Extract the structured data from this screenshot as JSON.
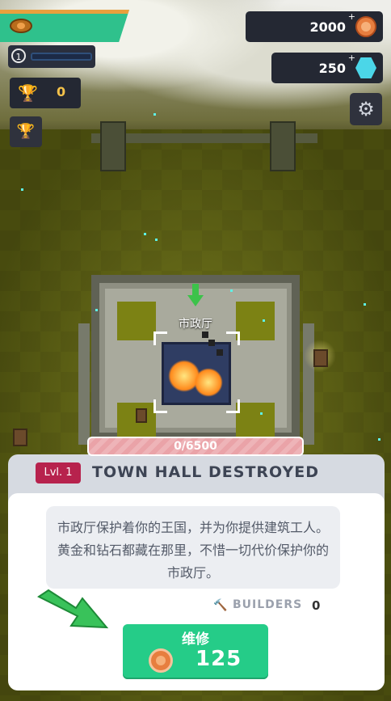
{
  "hud": {
    "level": "1",
    "trophies": "0",
    "gold": "2000",
    "gems": "250",
    "plus": "+"
  },
  "map": {
    "building_label": "市政厅"
  },
  "panel": {
    "progress_text": "0/6500",
    "level_badge": "Lvl. 1",
    "title": "TOWN HALL DESTROYED",
    "description": "市政厅保护着你的王国，并为你提供建筑工人。 黄金和钻石都藏在那里，不惜一切代价保护你的市政厅。",
    "builders_label": "BUILDERS",
    "builders_count": "0",
    "repair_label": "维修",
    "repair_cost": "125"
  },
  "icons": {
    "banner": "banner-coin-icon",
    "trophy": "trophy-icon",
    "gold": "coin-icon",
    "gem": "gem-icon",
    "settings": "gear-icon",
    "builders": "hammer-icon"
  },
  "colors": {
    "accent_green": "#25cc88",
    "banner_teal": "#2fc18c",
    "badge_red": "#b7224d",
    "progress_pink": "#eaa3a8"
  }
}
